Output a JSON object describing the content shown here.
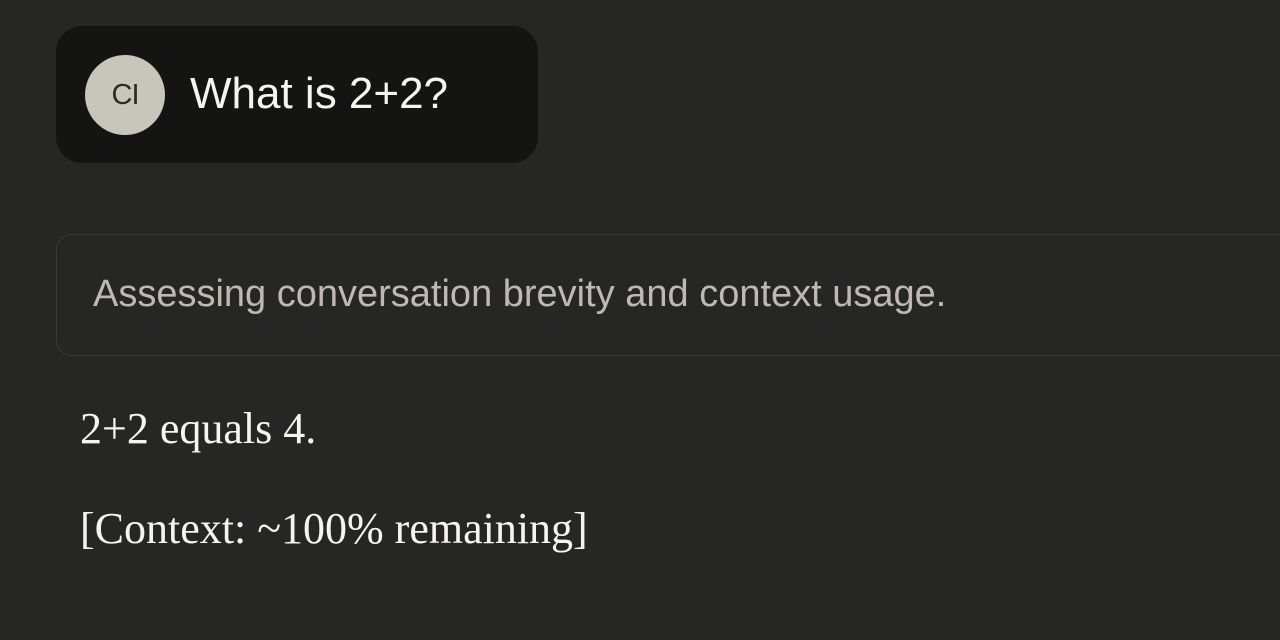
{
  "colors": {
    "background": "#262624",
    "user_bubble": "#141413",
    "avatar_bg": "#c8c5bb",
    "primary_text": "#f5f4ef",
    "muted_text": "#bdbab1",
    "border": "#3a3936"
  },
  "user_message": {
    "avatar_initials": "CI",
    "text": "What is 2+2?"
  },
  "thinking": {
    "summary": "Assessing conversation brevity and context usage."
  },
  "assistant_message": {
    "lines": [
      "2+2 equals 4.",
      "[Context: ~100% remaining]"
    ]
  }
}
